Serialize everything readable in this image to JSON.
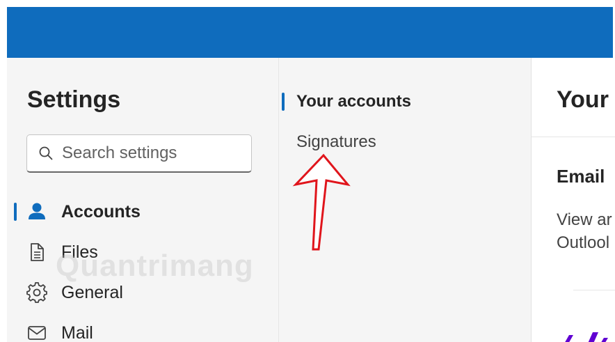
{
  "settings_nav": {
    "title": "Settings",
    "search_placeholder": "Search settings",
    "items": [
      {
        "label": "Accounts",
        "icon": "person-icon",
        "active": true
      },
      {
        "label": "Files",
        "icon": "document-icon"
      },
      {
        "label": "General",
        "icon": "gear-icon"
      },
      {
        "label": "Mail",
        "icon": "mail-icon"
      }
    ]
  },
  "accounts_nav": {
    "heading": "Your accounts",
    "items": [
      {
        "label": "Signatures"
      }
    ]
  },
  "content": {
    "title": "Your",
    "section_title": "Email",
    "section_desc_line1": "View ar",
    "section_desc_line2": "Outlool"
  },
  "watermark": "Quantrimang",
  "colors": {
    "brand_blue": "#0f6cbd",
    "arrow_red": "#e0151c",
    "yahoo_purple": "#6001d2"
  }
}
